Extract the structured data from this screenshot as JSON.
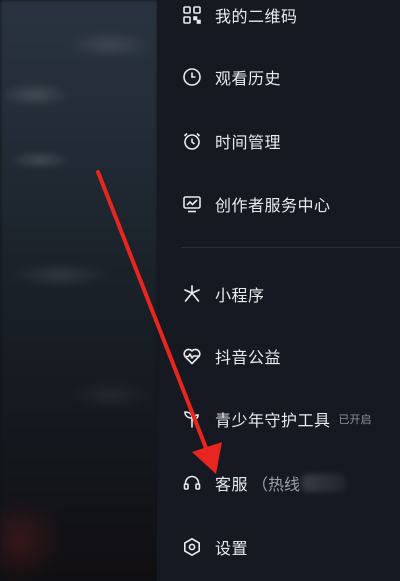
{
  "menu": {
    "items": [
      {
        "label": "我的二维码",
        "icon": "qr-code-icon"
      },
      {
        "label": "观看历史",
        "icon": "clock-icon"
      },
      {
        "label": "时间管理",
        "icon": "alarm-clock-icon"
      },
      {
        "label": "创作者服务中心",
        "icon": "creator-chart-icon"
      },
      {
        "label": "小程序",
        "icon": "mini-program-icon"
      },
      {
        "label": "抖音公益",
        "icon": "heart-pulse-icon"
      },
      {
        "label": "青少年守护工具",
        "icon": "sprout-icon",
        "badge": "已开启"
      },
      {
        "label": "客服",
        "extra": "（热线",
        "icon": "headset-icon"
      },
      {
        "label": "设置",
        "icon": "hexagon-settings-icon"
      }
    ]
  },
  "colors": {
    "panel_bg": "#161922",
    "text": "#e9eaee",
    "arrow": "#e8261f"
  }
}
